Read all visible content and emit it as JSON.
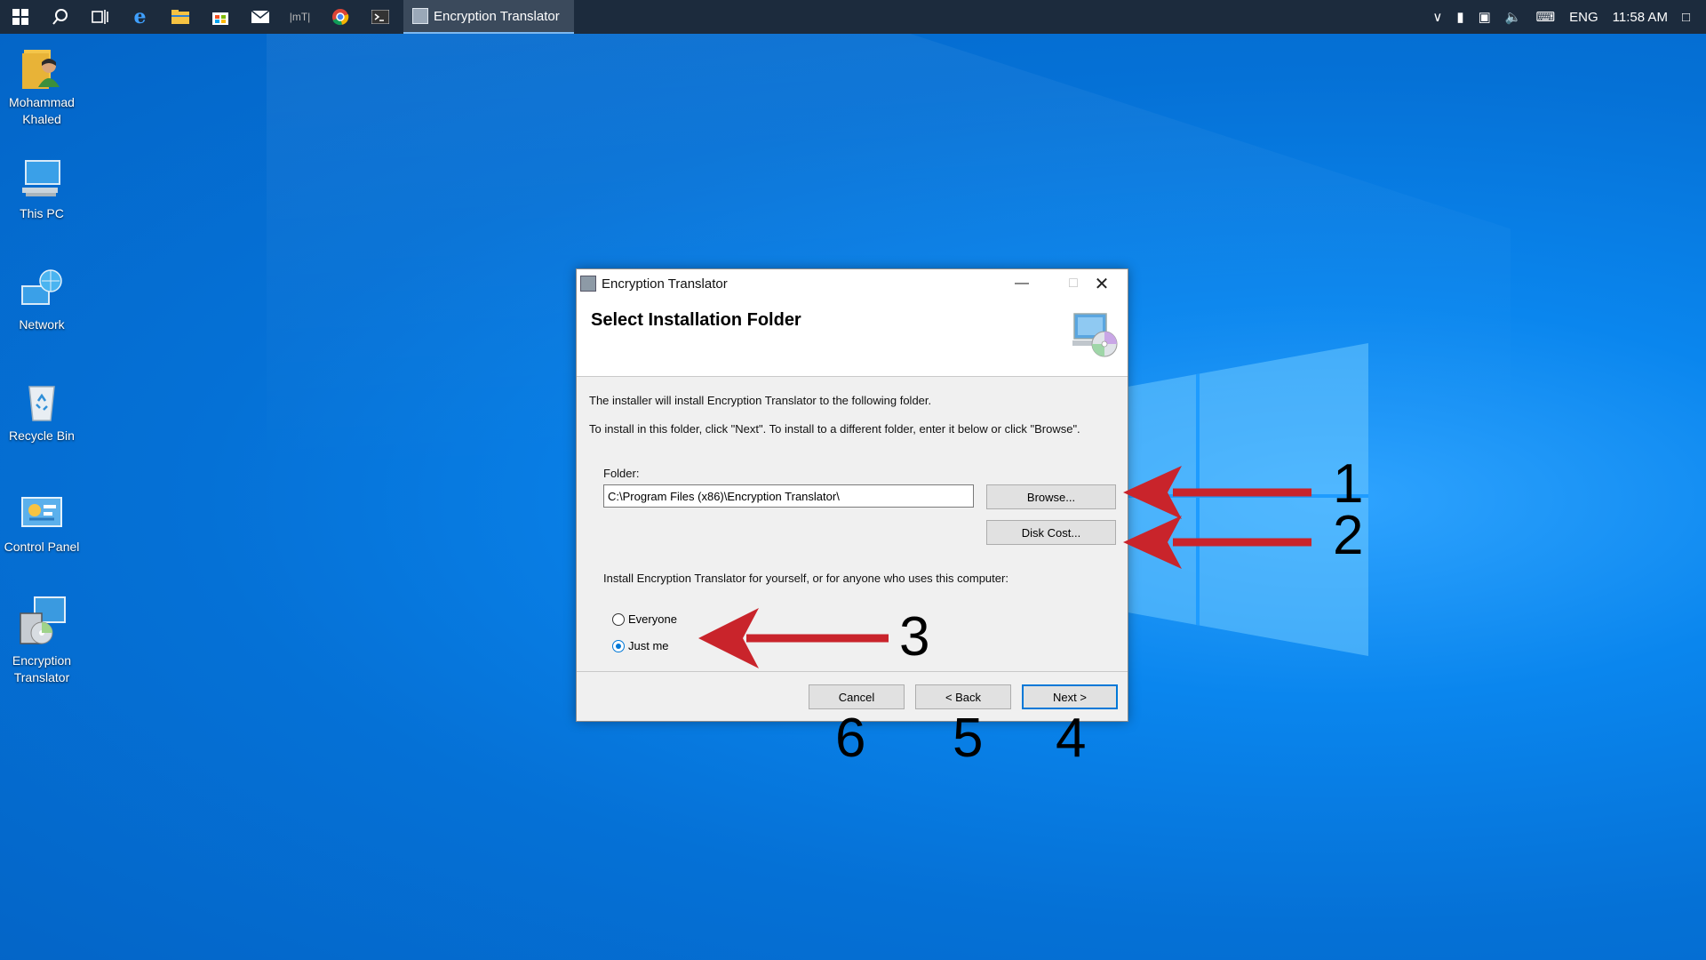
{
  "taskbar": {
    "icons": [
      "windows-start-icon",
      "search-icon",
      "task-view-icon",
      "edge-icon",
      "file-explorer-icon",
      "store-icon",
      "mail-icon",
      "mt-icon",
      "chrome-icon",
      "terminal-icon"
    ],
    "mt_label": "|mT|",
    "active_app": "Encryption Translator",
    "tray": {
      "language": "ENG",
      "time": "11:58 AM"
    }
  },
  "desktop_icons": [
    {
      "label": "Mohammad Khaled",
      "icon": "user-folder-icon"
    },
    {
      "label": "This PC",
      "icon": "computer-icon"
    },
    {
      "label": "Network",
      "icon": "network-icon"
    },
    {
      "label": "Recycle Bin",
      "icon": "recycle-bin-icon"
    },
    {
      "label": "Control Panel",
      "icon": "control-panel-icon"
    },
    {
      "label": "Encryption Translator",
      "icon": "installer-icon"
    }
  ],
  "dialog": {
    "title": "Encryption Translator",
    "heading": "Select Installation Folder",
    "line1": "The installer will install Encryption Translator to the following folder.",
    "line2": "To install in this folder, click \"Next\". To install to a different folder, enter it below or click \"Browse\".",
    "folder_label": "Folder:",
    "folder_value": "C:\\Program Files (x86)\\Encryption Translator\\",
    "browse_label": "Browse...",
    "disk_cost_label": "Disk Cost...",
    "install_for_text": "Install Encryption Translator for yourself, or for anyone who uses this computer:",
    "radio_everyone": "Everyone",
    "radio_justme": "Just me",
    "selected_radio": "Just me",
    "cancel_label": "Cancel",
    "back_label": "< Back",
    "next_label": "Next >"
  },
  "annotations": {
    "numbers": [
      "1",
      "2",
      "3",
      "4",
      "5",
      "6"
    ],
    "arrow_color": "#c9242b"
  }
}
